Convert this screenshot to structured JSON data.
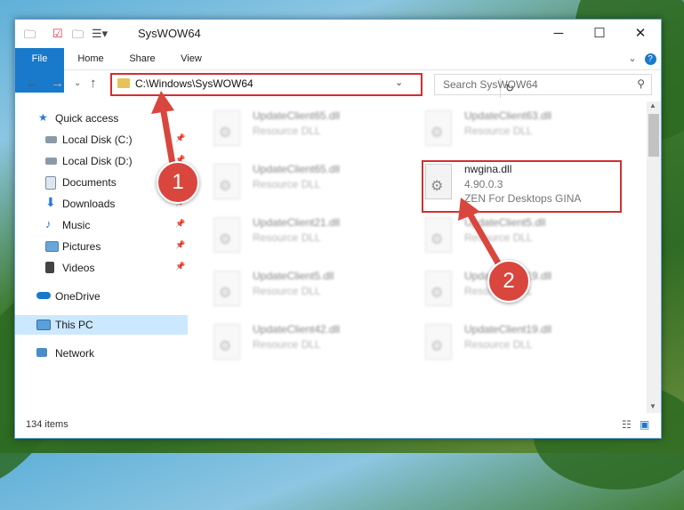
{
  "window": {
    "title": "SysWOW64",
    "tabs": [
      "File",
      "Home",
      "Share",
      "View"
    ]
  },
  "address": {
    "path": "C:\\Windows\\SysWOW64",
    "search_placeholder": "Search SysWOW64"
  },
  "sidebar": [
    {
      "label": "Quick access",
      "icon": "star-icon"
    },
    {
      "label": "Local Disk (C:)",
      "icon": "drive-icon",
      "pinned": true
    },
    {
      "label": "Local Disk (D:)",
      "icon": "drive-icon",
      "pinned": true
    },
    {
      "label": "Documents",
      "icon": "documents-icon",
      "pinned": true
    },
    {
      "label": "Downloads",
      "icon": "download-icon",
      "pinned": true
    },
    {
      "label": "Music",
      "icon": "music-icon",
      "pinned": true
    },
    {
      "label": "Pictures",
      "icon": "pictures-icon",
      "pinned": true
    },
    {
      "label": "Videos",
      "icon": "videos-icon",
      "pinned": true
    },
    {
      "label": "OneDrive",
      "icon": "cloud-icon"
    },
    {
      "label": "This PC",
      "icon": "computer-icon",
      "selected": true
    },
    {
      "label": "Network",
      "icon": "network-icon"
    }
  ],
  "files": [
    {
      "name": "UpdateClient65.dll",
      "line2": "Resource DLL"
    },
    {
      "name": "UpdateClient63.dll",
      "line2": "Resource DLL"
    },
    {
      "name": "UpdateClient65.dll",
      "line2": "Resource DLL"
    },
    {
      "name": "nwgina.dll",
      "line2": "4.90.0.3",
      "line3": "ZEN For Desktops GINA",
      "highlighted": true
    },
    {
      "name": "UpdateClient21.dll",
      "line2": "Resource DLL"
    },
    {
      "name": "UpdateClient5.dll",
      "line2": "Resource DLL"
    },
    {
      "name": "UpdateClient5.dll",
      "line2": "Resource DLL"
    },
    {
      "name": "UpdateClient19.dll",
      "line2": "Resource DLL"
    },
    {
      "name": "UpdateClient42.dll",
      "line2": "Resource DLL"
    },
    {
      "name": "UpdateClient19.dll",
      "line2": "Resource DLL"
    }
  ],
  "status": {
    "items": "134 items"
  },
  "annotations": {
    "badge1": "1",
    "badge2": "2"
  },
  "colors": {
    "accent": "#1979ca",
    "highlight": "#d32f2f",
    "badge": "#d9463e"
  }
}
